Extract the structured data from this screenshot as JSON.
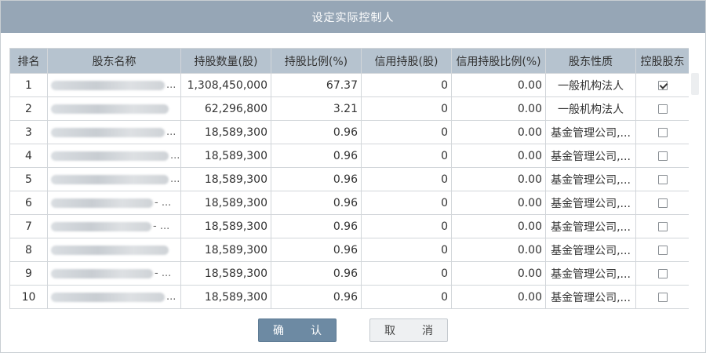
{
  "dialog": {
    "title": "设定实际控制人",
    "confirm_label": "确　认",
    "cancel_label": "取　消"
  },
  "table": {
    "headers": [
      "排名",
      "股东名称",
      "持股数量(股)",
      "持股比例(%)",
      "信用持股(股)",
      "信用持股比例(%)",
      "股东性质",
      "控股股东"
    ],
    "rows": [
      {
        "rank": "1",
        "name_tail": "...",
        "shares": "1,308,450,000",
        "ratio": "67.37",
        "credit": "0",
        "credit_ratio": "0.00",
        "nature": "一般机构法人",
        "checked": true
      },
      {
        "rank": "2",
        "name_tail": "",
        "shares": "62,296,800",
        "ratio": "3.21",
        "credit": "0",
        "credit_ratio": "0.00",
        "nature": "一般机构法人",
        "checked": false
      },
      {
        "rank": "3",
        "name_tail": "...",
        "shares": "18,589,300",
        "ratio": "0.96",
        "credit": "0",
        "credit_ratio": "0.00",
        "nature": "基金管理公司,...",
        "checked": false
      },
      {
        "rank": "4",
        "name_tail": "...",
        "shares": "18,589,300",
        "ratio": "0.96",
        "credit": "0",
        "credit_ratio": "0.00",
        "nature": "基金管理公司,...",
        "checked": false
      },
      {
        "rank": "5",
        "name_tail": "...",
        "shares": "18,589,300",
        "ratio": "0.96",
        "credit": "0",
        "credit_ratio": "0.00",
        "nature": "基金管理公司,...",
        "checked": false
      },
      {
        "rank": "6",
        "name_tail": "- ...",
        "shares": "18,589,300",
        "ratio": "0.96",
        "credit": "0",
        "credit_ratio": "0.00",
        "nature": "基金管理公司,...",
        "checked": false
      },
      {
        "rank": "7",
        "name_tail": "- ...",
        "shares": "18,589,300",
        "ratio": "0.96",
        "credit": "0",
        "credit_ratio": "0.00",
        "nature": "基金管理公司,...",
        "checked": false
      },
      {
        "rank": "8",
        "name_tail": "",
        "shares": "18,589,300",
        "ratio": "0.96",
        "credit": "0",
        "credit_ratio": "0.00",
        "nature": "基金管理公司,...",
        "checked": false
      },
      {
        "rank": "9",
        "name_tail": "- ...",
        "shares": "18,589,300",
        "ratio": "0.96",
        "credit": "0",
        "credit_ratio": "0.00",
        "nature": "基金管理公司,...",
        "checked": false
      },
      {
        "rank": "10",
        "name_tail": "...",
        "shares": "18,589,300",
        "ratio": "0.96",
        "credit": "0",
        "credit_ratio": "0.00",
        "nature": "基金管理公司,...",
        "checked": false
      }
    ]
  },
  "colors": {
    "title_bar": "#96a6b6",
    "header_bg": "#b6c3cf",
    "confirm_bg": "#6d8aa3",
    "cancel_bg": "#eef0f2"
  }
}
